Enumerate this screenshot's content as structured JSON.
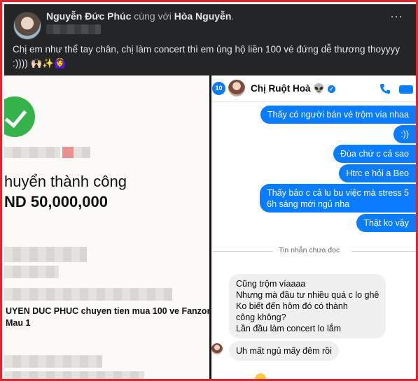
{
  "post": {
    "author": "Nguyễn Đức Phúc",
    "with_text": "cùng với",
    "tagged": "Hòa Nguyễn",
    "period": ".",
    "more_icon": "⋯",
    "caption": "Chị em như thể tay chân, chị làm concert thì em ủng hộ liền 100 vé đứng dễ thương thoyyyy :)))) 🙌🏻✨🙆‍♀️"
  },
  "transfer": {
    "status_title": "huyển thành công",
    "amount": "ND 50,000,000",
    "memo_line1": "UYEN DUC PHUC chuyen tien mua 100 ve Fanzon",
    "memo_line2": "Mau 1",
    "check_icon": "check-circle-icon",
    "accent": "#36b24a"
  },
  "chat": {
    "back_badge": "10",
    "name": "Chị Ruột Hoà 👽",
    "verified_icon": "✓",
    "accent": "#0a7cff",
    "outgoing": [
      "Thấy có người bán vé trộm vía nhaa",
      ":))",
      "Đùa chứ c cả sao",
      "Htrc e hỏi a Beo",
      "Thấy bảo c cả lu bu việc mà stress 5",
      "6h sáng mới ngủ nha",
      "Thật ko vậy"
    ],
    "unread_label": "Tin nhắn chưa đọc",
    "incoming": [
      "Cũng trộm víaaaa",
      "Nhưng mà đầu tư nhiều quá c lo ghê",
      "Ko biết đến hôm đó có thành",
      "công không?",
      "Lần đầu làm concert lo lắm"
    ],
    "incoming_last": "Uh mất ngủ mấy đêm rồi"
  }
}
